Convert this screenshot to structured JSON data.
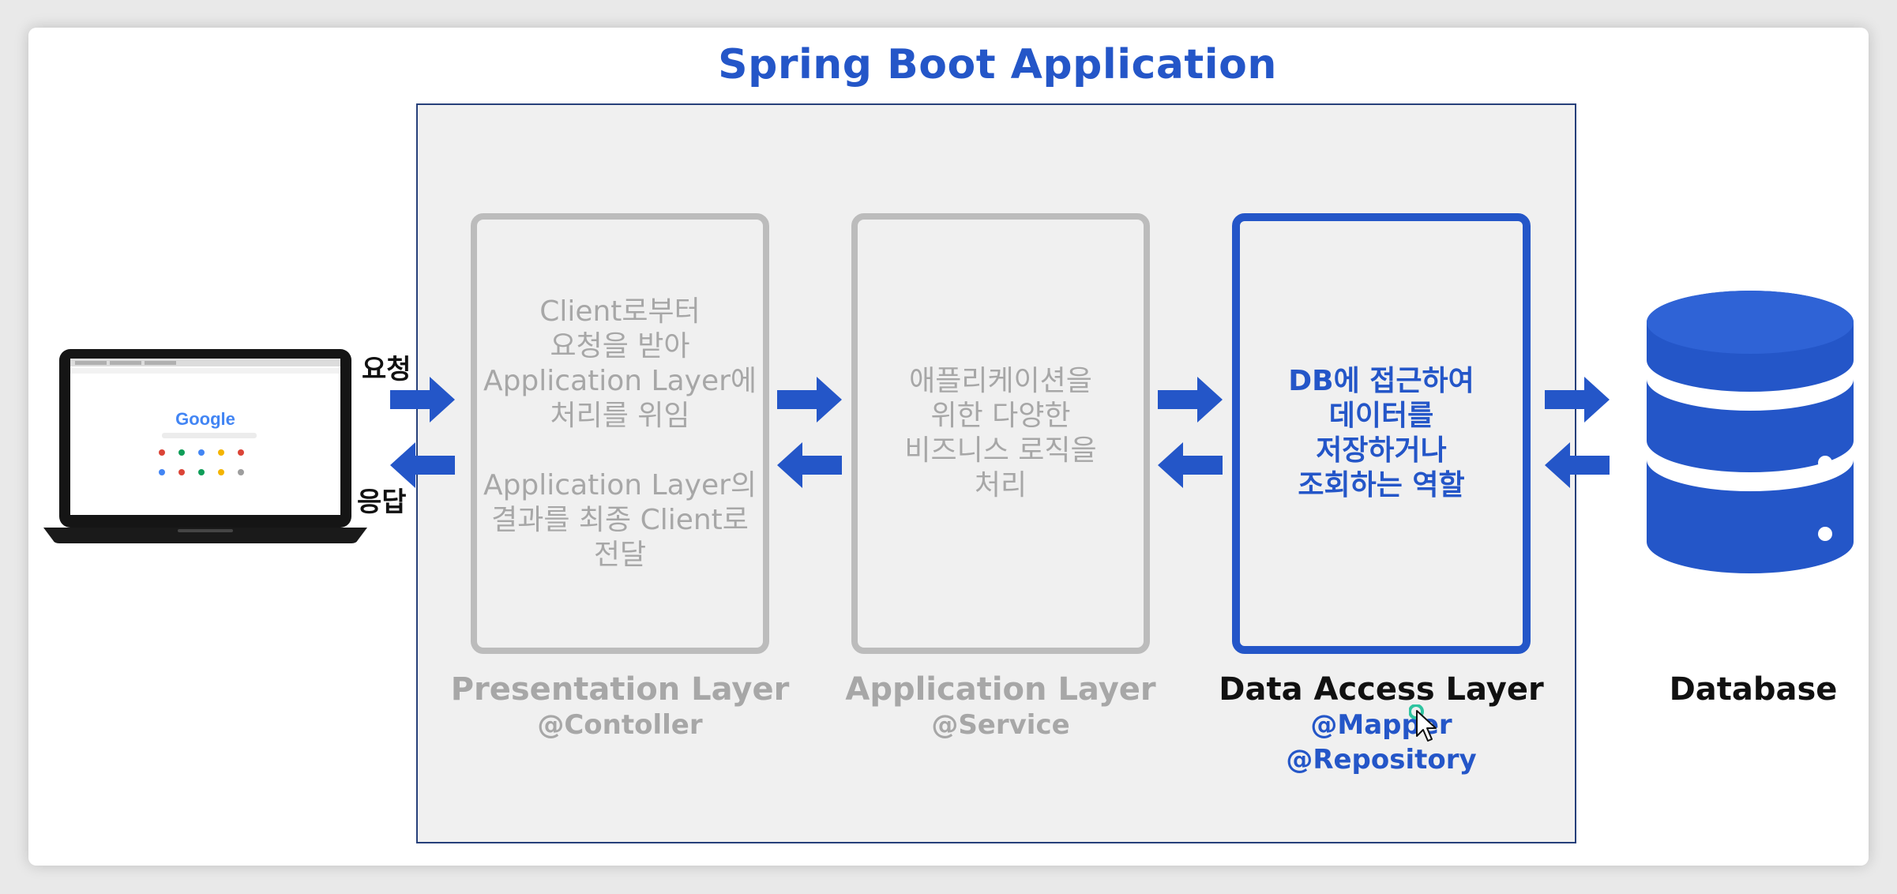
{
  "title": "Spring Boot Application",
  "client": {
    "request_label": "요청",
    "response_label": "응답",
    "browser_logo": "Google"
  },
  "layers": [
    {
      "name": "Presentation Layer",
      "annotation": "@Contoller",
      "active": false,
      "description_lines": [
        "Client로부터",
        "요청을 받아",
        "Application Layer에",
        "처리를 위임"
      ],
      "description_lines_2": [
        "Application Layer의",
        "결과를 최종 Client로",
        "전달"
      ]
    },
    {
      "name": "Application Layer",
      "annotation": "@Service",
      "active": false,
      "description_lines": [
        "애플리케이션을",
        "위한 다양한",
        "비즈니스 로직을",
        "처리"
      ]
    },
    {
      "name": "Data Access Layer",
      "annotations": [
        "@Mapper",
        "@Repository"
      ],
      "active": true,
      "description_lines": [
        "DB에 접근하여",
        "데이터를",
        "저장하거나",
        "조회하는 역할"
      ]
    }
  ],
  "database": {
    "label": "Database"
  },
  "colors": {
    "accent": "#2456c8",
    "inactive": "#a7a7a7",
    "panel": "#f0f0f0"
  },
  "icons": [
    "laptop-icon",
    "database-icon",
    "arrow-right-icon",
    "arrow-left-icon",
    "mouse-cursor-icon"
  ]
}
